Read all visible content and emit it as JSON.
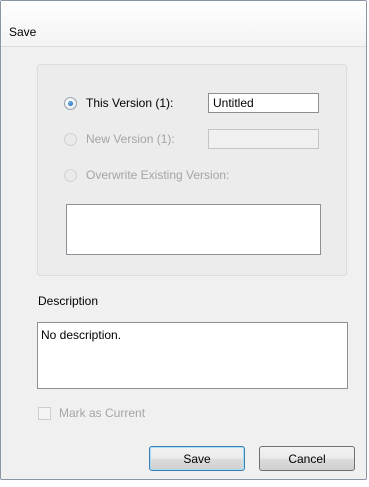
{
  "window": {
    "title": "Save"
  },
  "options": {
    "this_version_label": "This Version (1):",
    "this_version_value": "Untitled",
    "new_version_label": "New Version (1):",
    "new_version_value": "",
    "overwrite_label": "Overwrite Existing Version:",
    "selected": "this_version"
  },
  "description": {
    "label": "Description",
    "value": "No description."
  },
  "mark_as_current": {
    "label": "Mark as Current",
    "checked": false
  },
  "buttons": {
    "save": "Save",
    "cancel": "Cancel"
  },
  "colors": {
    "default_button_border": "#3c7fb1",
    "radio_selected": "#1f5d9c",
    "disabled_text": "#a5a5a5"
  }
}
